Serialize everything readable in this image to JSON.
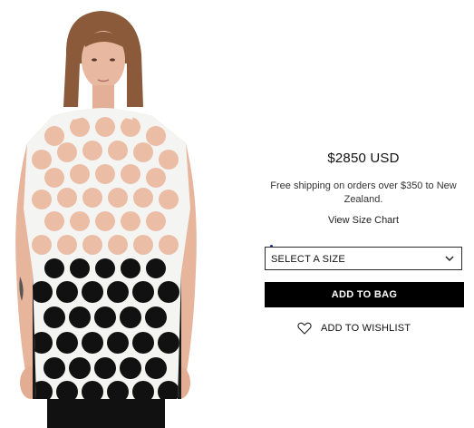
{
  "product": {
    "image_name": "sleeveless-perforated-top-photo",
    "price": "$2850 USD",
    "shipping_note": "Free shipping on orders over $350 to New Zealand.",
    "size_chart_link": "View Size Chart",
    "size_select": {
      "selected": "SELECT A SIZE",
      "icon": "chevron-down-icon"
    },
    "add_to_bag_label": "ADD TO BAG",
    "wishlist": {
      "icon": "heart-icon",
      "label": "ADD TO WISHLIST"
    }
  },
  "colors": {
    "button_bg": "#000000",
    "button_text": "#ffffff",
    "text": "#111111",
    "border": "#2b2b2b"
  }
}
